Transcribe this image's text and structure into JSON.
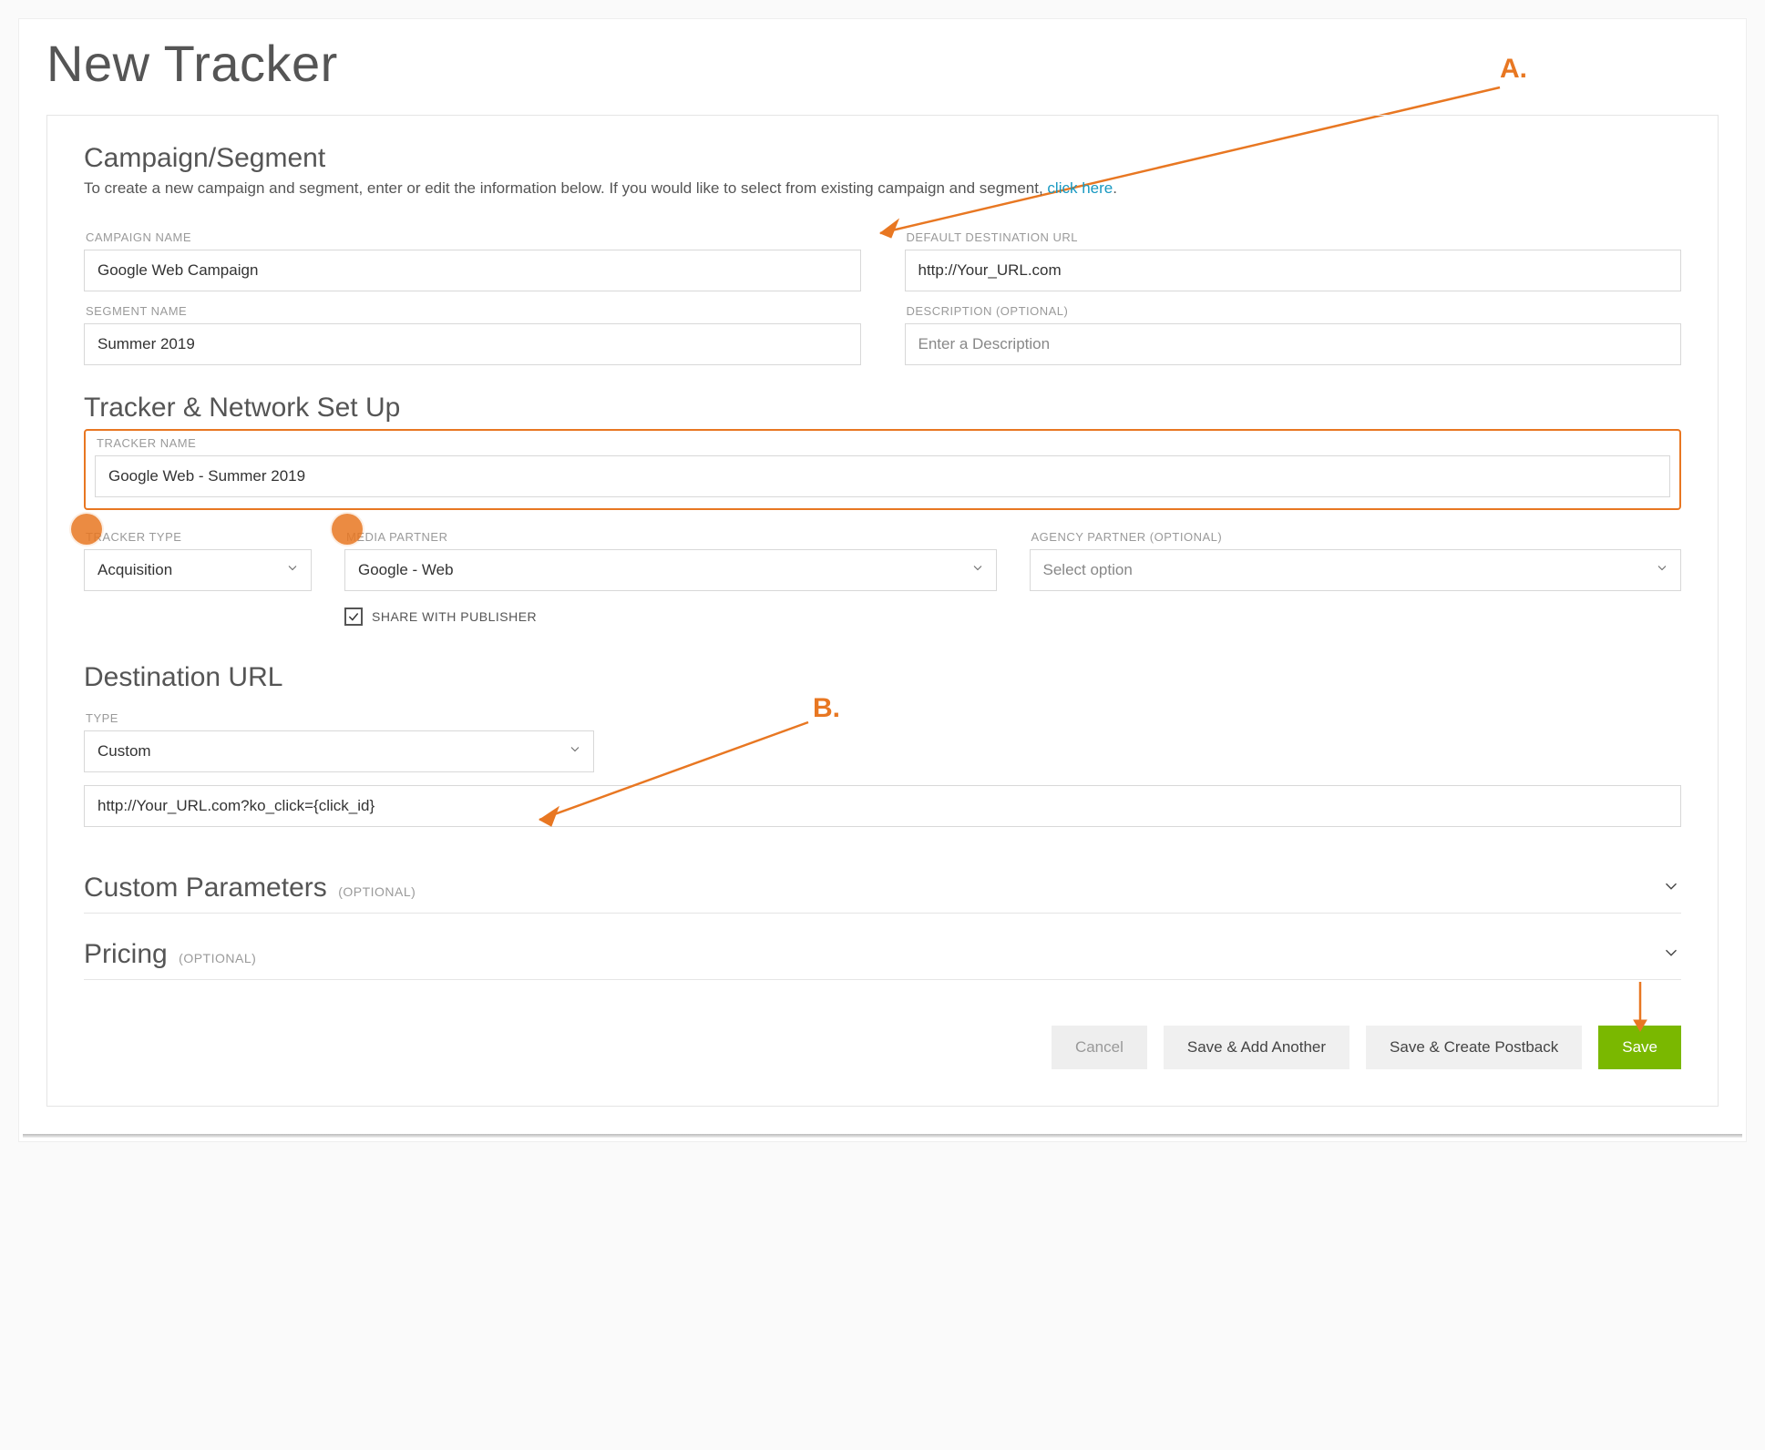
{
  "page": {
    "title": "New Tracker"
  },
  "callouts": {
    "a_label": "A.",
    "b_label": "B."
  },
  "campaign": {
    "section_title": "Campaign/Segment",
    "intro_text": "To create a new campaign and segment, enter or edit the information below. If you would like to select from existing campaign and segment, ",
    "intro_link": "click here",
    "intro_suffix": ".",
    "campaign_name_label": "CAMPAIGN NAME",
    "campaign_name_value": "Google Web Campaign",
    "default_url_label": "DEFAULT DESTINATION URL",
    "default_url_value": "http://Your_URL.com",
    "segment_name_label": "SEGMENT NAME",
    "segment_name_value": "Summer 2019",
    "description_label": "DESCRIPTION (OPTIONAL)",
    "description_placeholder": "Enter a Description"
  },
  "tracker": {
    "section_title": "Tracker & Network Set Up",
    "name_label": "TRACKER NAME",
    "name_value": "Google Web - Summer 2019",
    "type_label": "TRACKER TYPE",
    "type_value": "Acquisition",
    "media_label": "MEDIA PARTNER",
    "media_value": "Google - Web",
    "agency_label": "AGENCY PARTNER (OPTIONAL)",
    "agency_placeholder": "Select option",
    "share_label": "SHARE WITH PUBLISHER",
    "share_checked": true
  },
  "destination": {
    "section_title": "Destination URL",
    "type_label": "TYPE",
    "type_value": "Custom",
    "url_value": "http://Your_URL.com?ko_click={click_id}"
  },
  "custom_params": {
    "title": "Custom Parameters",
    "optional": "(OPTIONAL)"
  },
  "pricing": {
    "title": "Pricing",
    "optional": "(OPTIONAL)"
  },
  "actions": {
    "cancel": "Cancel",
    "save_add": "Save & Add Another",
    "save_postback": "Save & Create Postback",
    "save": "Save"
  }
}
